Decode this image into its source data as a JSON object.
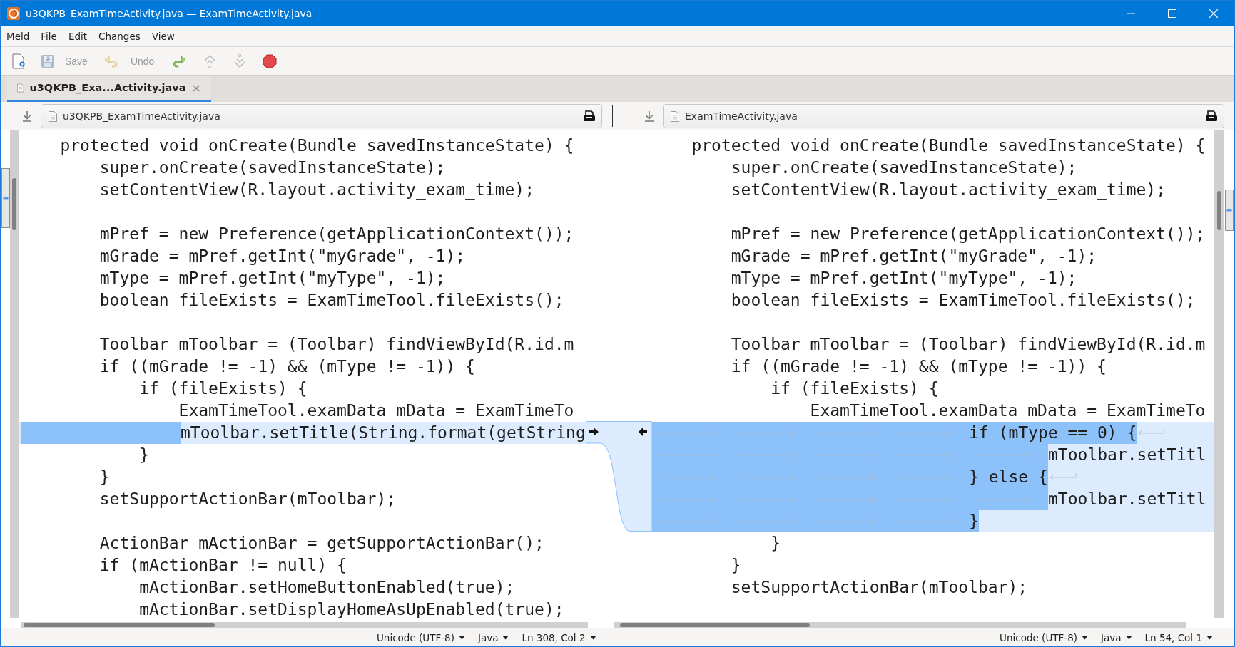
{
  "window": {
    "title": "u3QKPB_ExamTimeActivity.java — ExamTimeActivity.java"
  },
  "menu": [
    "Meld",
    "File",
    "Edit",
    "Changes",
    "View"
  ],
  "toolbar": [
    {
      "kind": "new",
      "disabled": false
    },
    {
      "kind": "save",
      "label": "Save",
      "disabled": true
    },
    {
      "kind": "undo",
      "label": "Undo",
      "disabled": true
    },
    {
      "kind": "redo",
      "disabled": false
    },
    {
      "kind": "previous",
      "disabled": true
    },
    {
      "kind": "next",
      "disabled": true
    },
    {
      "kind": "stop",
      "disabled": false
    }
  ],
  "tabs": [
    {
      "label": "u3QKPB_Exa...Activity.java",
      "selected": true,
      "close": "×"
    }
  ],
  "panes": [
    {
      "file": "u3QKPB_ExamTimeActivity.java",
      "lines": [
        {
          "kind": "code",
          "text": "    protected void onCreate(Bundle savedInstanceState) {"
        },
        {
          "kind": "code",
          "text": "        super.onCreate(savedInstanceState);"
        },
        {
          "kind": "code",
          "text": "        setContentView(R.layout.activity_exam_time);"
        },
        {
          "kind": "blank"
        },
        {
          "kind": "code",
          "text": "        mPref = new Preference(getApplicationContext());"
        },
        {
          "kind": "code",
          "text": "        mGrade = mPref.getInt(\"myGrade\", -1);"
        },
        {
          "kind": "code",
          "text": "        mType = mPref.getInt(\"myType\", -1);"
        },
        {
          "kind": "code",
          "text": "        boolean fileExists = ExamTimeTool.fileExists();"
        },
        {
          "kind": "blank"
        },
        {
          "kind": "code",
          "text": "        Toolbar mToolbar = (Toolbar) findViewById(R.id.m"
        },
        {
          "kind": "code",
          "text": "        if ((mGrade != -1) && (mType != -1)) {"
        },
        {
          "kind": "code",
          "text": "            if (fileExists) {"
        },
        {
          "kind": "code",
          "text": "                ExamTimeTool.examData mData = ExamTimeTo"
        },
        {
          "kind": "changed",
          "segments": [
            {
              "kind": "space",
              "inline_change": true
            },
            {
              "kind": "space",
              "inline_change": true
            },
            {
              "kind": "space",
              "inline_change": true
            },
            {
              "kind": "space",
              "inline_change": true
            },
            {
              "kind": "space",
              "inline_change": true
            },
            {
              "kind": "space",
              "inline_change": true
            },
            {
              "kind": "space",
              "inline_change": true
            },
            {
              "kind": "space",
              "inline_change": true
            },
            {
              "kind": "space",
              "inline_change": true
            },
            {
              "kind": "space",
              "inline_change": true
            },
            {
              "kind": "space",
              "inline_change": true
            },
            {
              "kind": "space",
              "inline_change": true
            },
            {
              "kind": "space",
              "inline_change": true
            },
            {
              "kind": "space",
              "inline_change": true
            },
            {
              "kind": "space",
              "inline_change": true
            },
            {
              "kind": "space",
              "inline_change": true
            },
            {
              "kind": "text",
              "text": "mToolbar.setTitle(String.format(getString",
              "inline_change": false
            }
          ]
        },
        {
          "kind": "code",
          "text": "            }"
        },
        {
          "kind": "code",
          "text": "        }"
        },
        {
          "kind": "code",
          "text": "        setSupportActionBar(mToolbar);"
        },
        {
          "kind": "blank"
        },
        {
          "kind": "code",
          "text": "        ActionBar mActionBar = getSupportActionBar();"
        },
        {
          "kind": "code",
          "text": "        if (mActionBar != null) {"
        },
        {
          "kind": "code",
          "text": "            mActionBar.setHomeButtonEnabled(true);"
        },
        {
          "kind": "code",
          "text": "            mActionBar.setDisplayHomeAsUpEnabled(true);"
        }
      ],
      "status": {
        "encoding": "Unicode (UTF-8)",
        "language": "Java",
        "position": "Ln 308, Col 2"
      }
    },
    {
      "file": "ExamTimeActivity.java",
      "lines": [
        {
          "kind": "code",
          "text": "    protected void onCreate(Bundle savedInstanceState) {"
        },
        {
          "kind": "code",
          "text": "        super.onCreate(savedInstanceState);"
        },
        {
          "kind": "code",
          "text": "        setContentView(R.layout.activity_exam_time);"
        },
        {
          "kind": "blank"
        },
        {
          "kind": "code",
          "text": "        mPref = new Preference(getApplicationContext());"
        },
        {
          "kind": "code",
          "text": "        mGrade = mPref.getInt(\"myGrade\", -1);"
        },
        {
          "kind": "code",
          "text": "        mType = mPref.getInt(\"myType\", -1);"
        },
        {
          "kind": "code",
          "text": "        boolean fileExists = ExamTimeTool.fileExists();"
        },
        {
          "kind": "blank"
        },
        {
          "kind": "code",
          "text": "        Toolbar mToolbar = (Toolbar) findViewById(R.id.m"
        },
        {
          "kind": "code",
          "text": "        if ((mGrade != -1) && (mType != -1)) {"
        },
        {
          "kind": "code",
          "text": "            if (fileExists) {"
        },
        {
          "kind": "code",
          "text": "                ExamTimeTool.examData mData = ExamTimeTo"
        },
        {
          "kind": "changed",
          "segments": [
            {
              "kind": "tab",
              "inline_change": true
            },
            {
              "kind": "tab",
              "inline_change": true
            },
            {
              "kind": "tab",
              "inline_change": true
            },
            {
              "kind": "tab",
              "inline_change": true
            },
            {
              "kind": "text",
              "text": "if (mType == 0) {",
              "inline_change": true
            },
            {
              "kind": "newline",
              "inline_change": false
            }
          ]
        },
        {
          "kind": "changed",
          "segments": [
            {
              "kind": "tab",
              "inline_change": true
            },
            {
              "kind": "tab",
              "inline_change": true
            },
            {
              "kind": "tab",
              "inline_change": true
            },
            {
              "kind": "tab",
              "inline_change": true
            },
            {
              "kind": "tab",
              "inline_change": true
            },
            {
              "kind": "text",
              "text": "mToolbar.setTitl",
              "inline_change": false
            }
          ]
        },
        {
          "kind": "changed",
          "segments": [
            {
              "kind": "tab",
              "inline_change": true
            },
            {
              "kind": "tab",
              "inline_change": true
            },
            {
              "kind": "tab",
              "inline_change": true
            },
            {
              "kind": "tab",
              "inline_change": true
            },
            {
              "kind": "text",
              "text": "} else {",
              "inline_change": true
            },
            {
              "kind": "newline",
              "inline_change": false
            }
          ]
        },
        {
          "kind": "changed",
          "segments": [
            {
              "kind": "tab",
              "inline_change": true
            },
            {
              "kind": "tab",
              "inline_change": true
            },
            {
              "kind": "tab",
              "inline_change": true
            },
            {
              "kind": "tab",
              "inline_change": true
            },
            {
              "kind": "tab",
              "inline_change": true
            },
            {
              "kind": "text",
              "text": "mToolbar.setTitl",
              "inline_change": false
            }
          ]
        },
        {
          "kind": "changed",
          "segments": [
            {
              "kind": "tab",
              "inline_change": true
            },
            {
              "kind": "tab",
              "inline_change": true
            },
            {
              "kind": "tab",
              "inline_change": true
            },
            {
              "kind": "tab",
              "inline_change": true
            },
            {
              "kind": "text",
              "text": "}",
              "inline_change": true
            }
          ]
        },
        {
          "kind": "code",
          "text": "            }"
        },
        {
          "kind": "code",
          "text": "        }"
        },
        {
          "kind": "code",
          "text": "        setSupportActionBar(mToolbar);"
        },
        {
          "kind": "blank"
        }
      ],
      "status": {
        "encoding": "Unicode (UTF-8)",
        "language": "Java",
        "position": "Ln 54, Col 1"
      }
    }
  ]
}
